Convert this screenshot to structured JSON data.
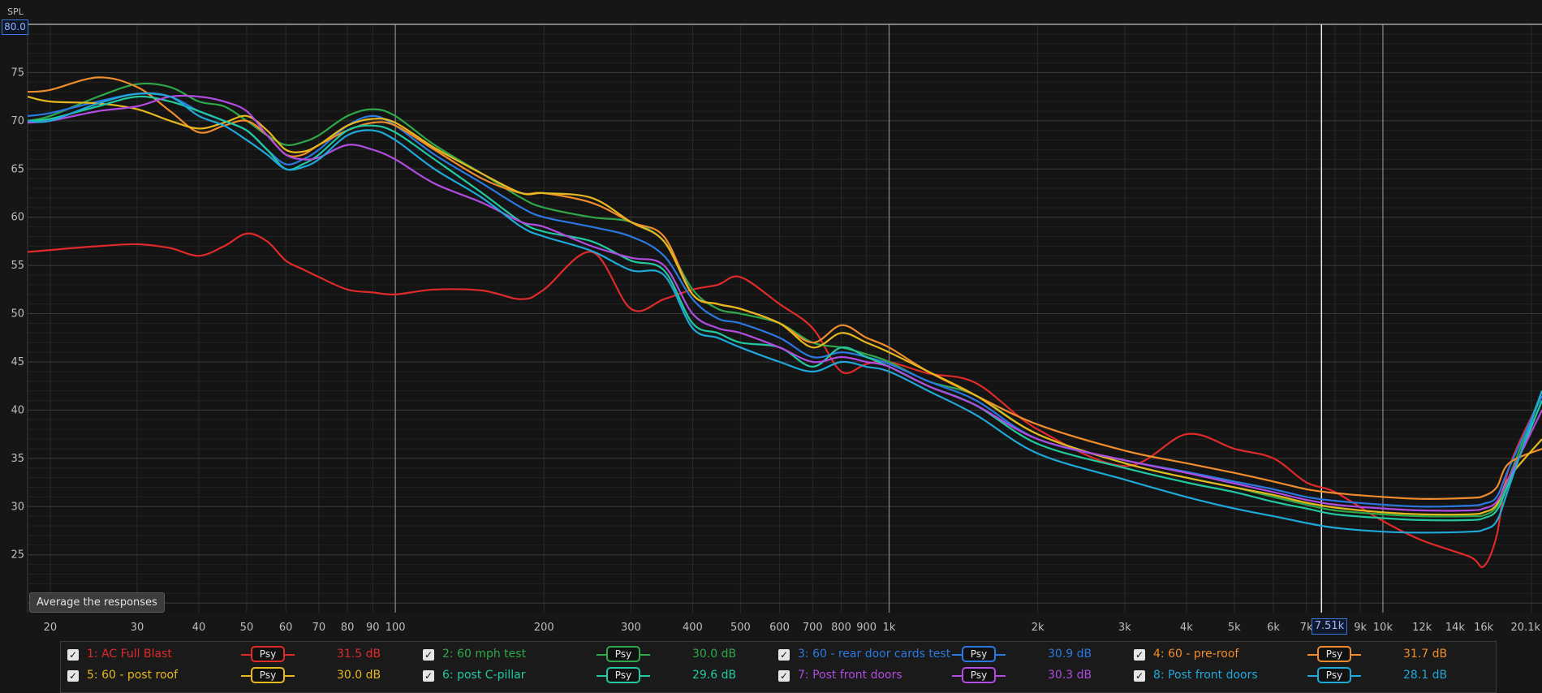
{
  "y_axis_title": "SPL",
  "y_max_value": "80.0",
  "average_button_label": "Average the responses",
  "cursor_freq_label": "7.51k",
  "chart_data": {
    "type": "line",
    "x_scale": "log",
    "xlim": [
      18,
      21000
    ],
    "ylim": [
      19,
      80
    ],
    "grid": true,
    "x_ticks": [
      {
        "v": 20,
        "l": "20"
      },
      {
        "v": 30,
        "l": "30"
      },
      {
        "v": 40,
        "l": "40"
      },
      {
        "v": 50,
        "l": "50"
      },
      {
        "v": 60,
        "l": "60"
      },
      {
        "v": 70,
        "l": "70"
      },
      {
        "v": 80,
        "l": "80"
      },
      {
        "v": 90,
        "l": "90"
      },
      {
        "v": 100,
        "l": "100"
      },
      {
        "v": 200,
        "l": "200"
      },
      {
        "v": 300,
        "l": "300"
      },
      {
        "v": 400,
        "l": "400"
      },
      {
        "v": 500,
        "l": "500"
      },
      {
        "v": 600,
        "l": "600"
      },
      {
        "v": 700,
        "l": "700"
      },
      {
        "v": 800,
        "l": "800"
      },
      {
        "v": 900,
        "l": "900"
      },
      {
        "v": 1000,
        "l": "1k"
      },
      {
        "v": 2000,
        "l": "2k"
      },
      {
        "v": 3000,
        "l": "3k"
      },
      {
        "v": 4000,
        "l": "4k"
      },
      {
        "v": 5000,
        "l": "5k"
      },
      {
        "v": 6000,
        "l": "6k"
      },
      {
        "v": 7000,
        "l": "7k"
      },
      {
        "v": 8000,
        "l": "8k"
      },
      {
        "v": 9000,
        "l": "9k"
      },
      {
        "v": 10000,
        "l": "10k"
      },
      {
        "v": 12000,
        "l": "12k"
      },
      {
        "v": 14000,
        "l": "14k"
      },
      {
        "v": 16000,
        "l": "16k"
      },
      {
        "v": 20100,
        "l": "20.1k"
      }
    ],
    "y_ticks": [
      25,
      30,
      35,
      40,
      45,
      50,
      55,
      60,
      65,
      70,
      75
    ],
    "cursor_x": 7510,
    "x": [
      18,
      20,
      25,
      30,
      35,
      40,
      45,
      50,
      55,
      60,
      65,
      70,
      80,
      90,
      100,
      120,
      150,
      180,
      200,
      250,
      300,
      350,
      400,
      450,
      500,
      600,
      700,
      800,
      900,
      1000,
      1200,
      1500,
      2000,
      3000,
      4000,
      5000,
      6000,
      7000,
      8000,
      10000,
      12000,
      15000,
      16000,
      17000,
      18000,
      21000
    ],
    "series": [
      {
        "name": "1: AC Full Blast",
        "color": "#e02a2a",
        "db": "31.5 dB",
        "values": [
          56.4,
          56.6,
          57.0,
          57.2,
          56.8,
          56.0,
          57.0,
          58.3,
          57.5,
          55.5,
          54.6,
          53.8,
          52.5,
          52.2,
          52.0,
          52.5,
          52.4,
          51.5,
          52.5,
          56.4,
          50.5,
          51.5,
          52.5,
          53.0,
          53.8,
          51.0,
          48.5,
          44.0,
          44.8,
          45.0,
          43.8,
          42.8,
          38.0,
          34.2,
          37.5,
          36.0,
          35.0,
          32.5,
          31.5,
          28.5,
          26.5,
          24.8,
          23.8,
          27.0,
          34.0,
          41.5
        ]
      },
      {
        "name": "2: 60 mph test",
        "color": "#2fa84a",
        "db": "30.0 dB",
        "values": [
          70.0,
          70.5,
          72.5,
          73.8,
          73.5,
          72.0,
          71.5,
          70.0,
          68.5,
          67.5,
          67.8,
          68.5,
          70.5,
          71.2,
          70.5,
          67.5,
          64.5,
          62.0,
          61.0,
          60.0,
          59.5,
          57.5,
          52.5,
          50.5,
          50.0,
          49.0,
          47.0,
          46.5,
          45.8,
          45.0,
          43.0,
          41.5,
          37.5,
          34.5,
          33.0,
          32.0,
          31.0,
          30.2,
          29.6,
          29.2,
          29.0,
          29.0,
          29.1,
          30.0,
          33.0,
          42.0
        ]
      },
      {
        "name": "3: 60 - rear door cards test",
        "color": "#2a78e0",
        "db": "30.9 dB",
        "values": [
          70.5,
          70.8,
          72.0,
          72.8,
          72.5,
          71.0,
          70.0,
          69.0,
          67.0,
          65.5,
          66.0,
          67.0,
          69.5,
          70.5,
          69.5,
          66.5,
          63.5,
          61.0,
          60.0,
          59.0,
          58.0,
          56.0,
          51.5,
          49.5,
          49.0,
          47.5,
          45.5,
          46.0,
          45.5,
          44.8,
          43.0,
          41.0,
          37.0,
          34.8,
          33.6,
          32.6,
          31.8,
          31.0,
          30.6,
          30.2,
          30.0,
          30.1,
          30.3,
          31.0,
          34.0,
          41.5
        ]
      },
      {
        "name": "4: 60 - pre-roof",
        "color": "#f08c2c",
        "db": "31.7 dB",
        "values": [
          73.0,
          73.2,
          74.5,
          73.5,
          71.0,
          68.8,
          69.5,
          70.0,
          68.5,
          66.5,
          66.5,
          67.5,
          69.0,
          69.8,
          69.5,
          67.0,
          64.0,
          62.5,
          62.5,
          61.5,
          59.5,
          58.0,
          52.0,
          51.0,
          50.5,
          49.0,
          47.0,
          48.8,
          47.5,
          46.5,
          44.0,
          41.5,
          38.5,
          35.8,
          34.5,
          33.5,
          32.6,
          31.8,
          31.4,
          31.0,
          30.8,
          30.9,
          31.1,
          32.0,
          34.5,
          36.0
        ]
      },
      {
        "name": "5: 60 - post roof",
        "color": "#e6b820",
        "db": "30.0 dB",
        "values": [
          72.5,
          72.0,
          71.8,
          71.2,
          70.0,
          69.2,
          69.8,
          70.5,
          69.0,
          67.0,
          66.8,
          67.5,
          69.5,
          70.2,
          69.8,
          67.2,
          64.5,
          62.5,
          62.5,
          62.0,
          59.5,
          57.5,
          52.0,
          51.0,
          50.5,
          49.0,
          46.5,
          48.0,
          47.0,
          46.0,
          44.0,
          41.5,
          37.5,
          34.5,
          33.0,
          32.0,
          31.2,
          30.4,
          29.9,
          29.4,
          29.2,
          29.2,
          29.4,
          30.2,
          33.0,
          37.0
        ]
      },
      {
        "name": "6: post C-pillar",
        "color": "#22c9a0",
        "db": "29.6 dB",
        "values": [
          70.0,
          70.2,
          71.5,
          72.5,
          72.0,
          71.0,
          70.0,
          69.0,
          67.0,
          65.0,
          65.5,
          66.5,
          69.0,
          69.5,
          68.8,
          66.0,
          62.5,
          59.5,
          58.5,
          57.5,
          55.5,
          54.5,
          49.0,
          48.0,
          47.0,
          46.5,
          44.5,
          46.5,
          45.5,
          44.5,
          42.5,
          40.5,
          36.5,
          34.0,
          32.5,
          31.5,
          30.5,
          29.8,
          29.2,
          28.8,
          28.6,
          28.6,
          28.8,
          29.6,
          32.5,
          41.0
        ]
      },
      {
        "name": "7: Post front doors",
        "color": "#b04ce0",
        "db": "30.3 dB",
        "values": [
          69.8,
          70.0,
          71.0,
          71.5,
          72.5,
          72.5,
          72.0,
          71.0,
          68.5,
          66.5,
          66.0,
          66.2,
          67.5,
          67.0,
          66.0,
          63.5,
          61.5,
          59.5,
          59.0,
          57.0,
          55.8,
          55.0,
          50.0,
          48.5,
          48.0,
          46.5,
          45.0,
          45.5,
          45.0,
          44.5,
          42.5,
          40.5,
          37.0,
          34.8,
          33.5,
          32.4,
          31.5,
          30.7,
          30.2,
          29.8,
          29.6,
          29.6,
          29.8,
          30.5,
          33.0,
          40.0
        ]
      },
      {
        "name": "8: Post front doors",
        "color": "#1fa8d8",
        "db": "28.1 dB",
        "values": [
          70.0,
          70.0,
          71.8,
          72.8,
          72.5,
          70.5,
          69.5,
          68.0,
          66.5,
          65.0,
          65.2,
          66.0,
          68.5,
          69.0,
          68.0,
          65.0,
          62.0,
          59.0,
          58.0,
          56.5,
          54.5,
          54.0,
          48.5,
          47.5,
          46.5,
          45.0,
          44.0,
          45.0,
          44.5,
          44.0,
          42.0,
          39.5,
          35.5,
          32.8,
          31.0,
          29.8,
          29.0,
          28.3,
          27.8,
          27.4,
          27.3,
          27.4,
          27.6,
          28.5,
          32.0,
          42.0
        ]
      }
    ]
  },
  "legend": {
    "psy_label": "Psy",
    "entries": [
      {
        "name": "1: AC Full Blast",
        "db": "31.5 dB",
        "color": "#e02a2a"
      },
      {
        "name": "2: 60 mph test",
        "db": "30.0 dB",
        "color": "#2fa84a"
      },
      {
        "name": "3: 60 - rear door cards test",
        "db": "30.9 dB",
        "color": "#2a78e0"
      },
      {
        "name": "4: 60 - pre-roof",
        "db": "31.7 dB",
        "color": "#f08c2c"
      },
      {
        "name": "5: 60 - post roof",
        "db": "30.0 dB",
        "color": "#e6b820"
      },
      {
        "name": "6: post C-pillar",
        "db": "29.6 dB",
        "color": "#22c9a0"
      },
      {
        "name": "7: Post front doors",
        "db": "30.3 dB",
        "color": "#b04ce0"
      },
      {
        "name": "8: Post front doors",
        "db": "28.1 dB",
        "color": "#1fa8d8"
      }
    ]
  }
}
